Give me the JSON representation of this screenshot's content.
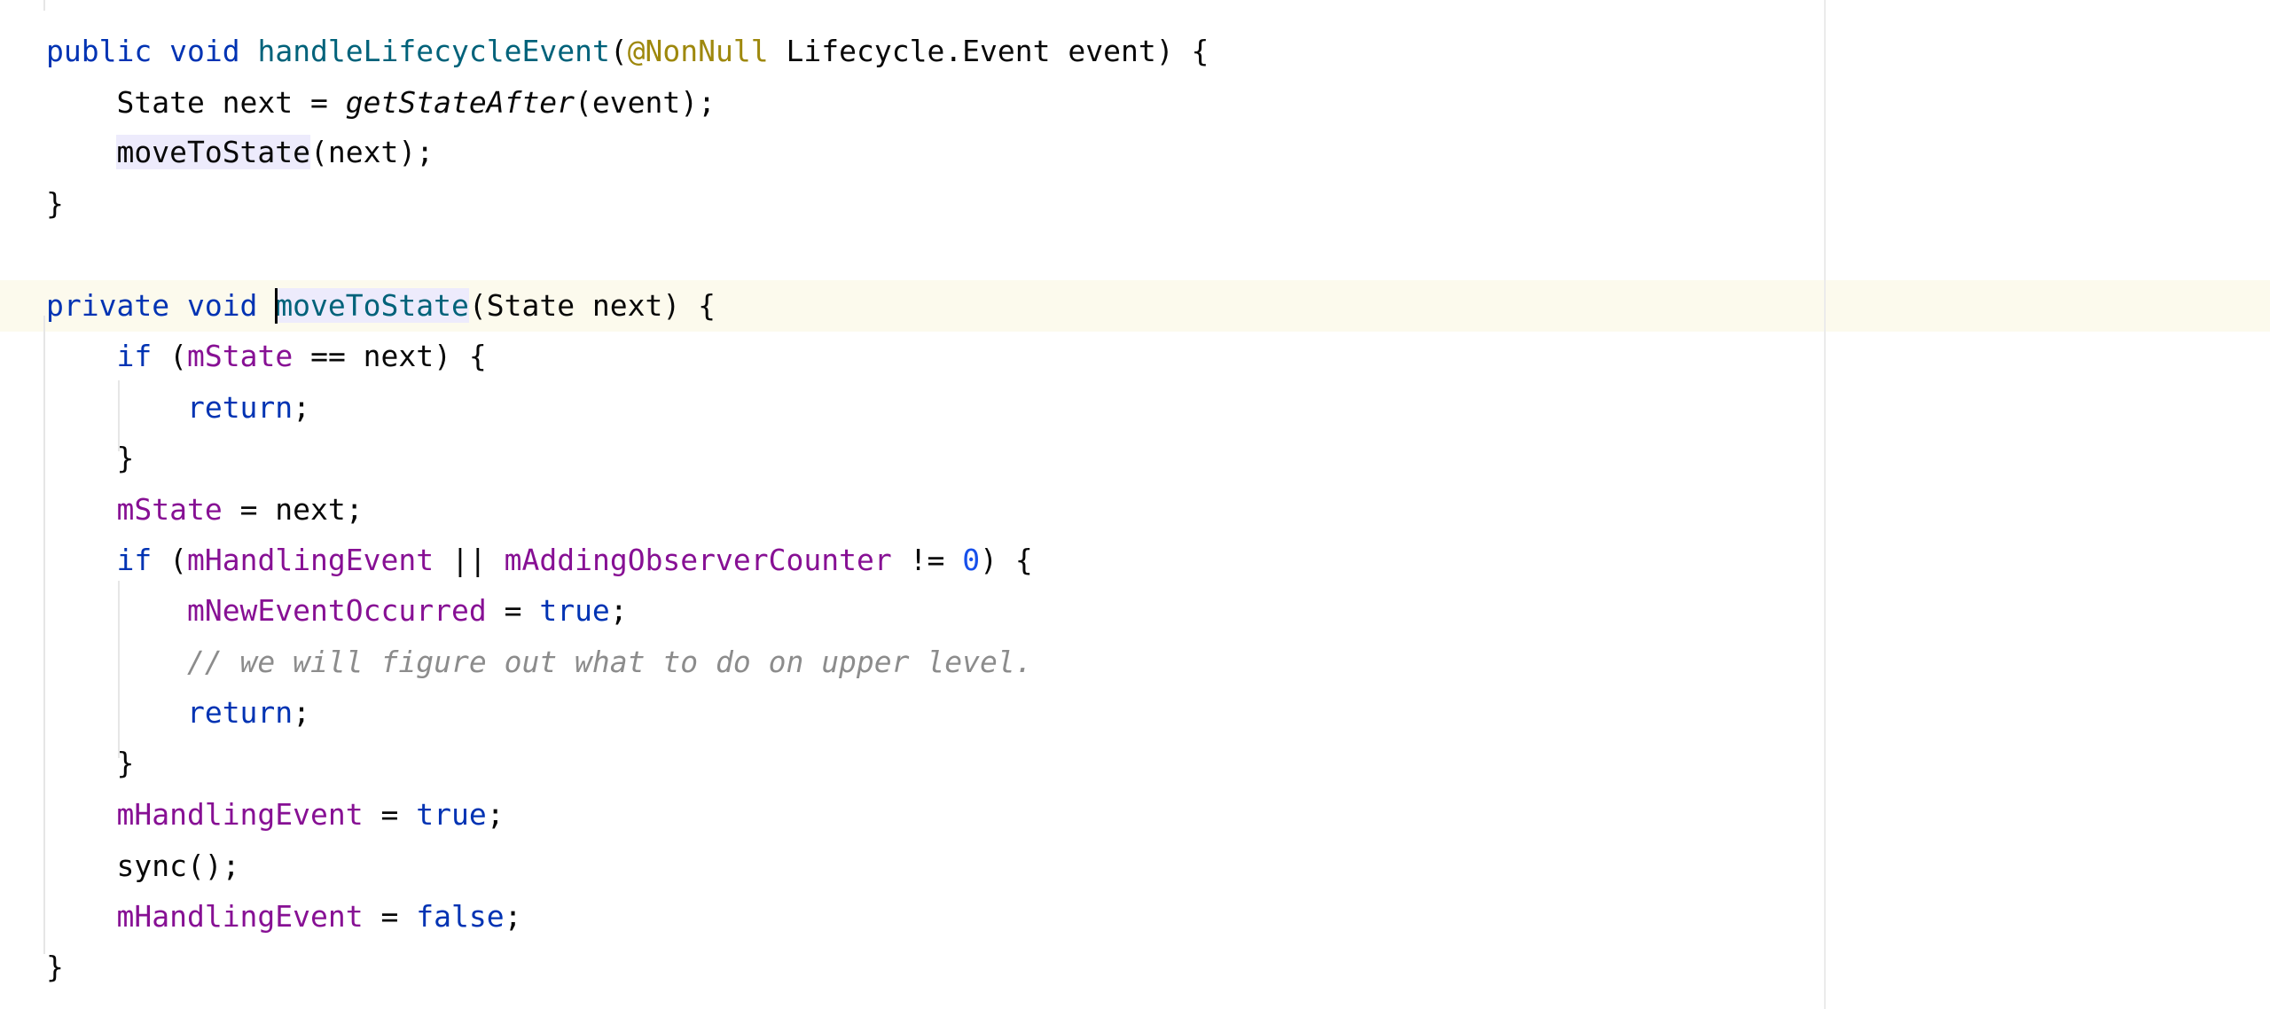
{
  "editor": {
    "lines": [
      {
        "tokens": [
          {
            "t": "public",
            "c": "kw"
          },
          {
            "t": " "
          },
          {
            "t": "void",
            "c": "kw"
          },
          {
            "t": " "
          },
          {
            "t": "handleLifecycleEvent",
            "c": "fn"
          },
          {
            "t": "("
          },
          {
            "t": "@NonNull",
            "c": "ann"
          },
          {
            "t": " Lifecycle.Event event) {"
          }
        ]
      },
      {
        "tokens": [
          {
            "t": "    State next = "
          },
          {
            "t": "getStateAfter",
            "c": "ital"
          },
          {
            "t": "(event);"
          }
        ]
      },
      {
        "tokens": [
          {
            "t": "    "
          },
          {
            "t": "moveToState",
            "c": "usage-hl"
          },
          {
            "t": "(next);"
          }
        ]
      },
      {
        "tokens": [
          {
            "t": "}"
          }
        ]
      },
      {
        "tokens": []
      },
      {
        "tokens": [
          {
            "t": "private",
            "c": "kw"
          },
          {
            "t": " "
          },
          {
            "t": "void",
            "c": "kw"
          },
          {
            "t": " "
          },
          {
            "caret": true
          },
          {
            "t": "moveToState",
            "c": "fn usage-hl"
          },
          {
            "t": "(State next) {"
          }
        ]
      },
      {
        "tokens": [
          {
            "t": "    "
          },
          {
            "t": "if",
            "c": "kw"
          },
          {
            "t": " ("
          },
          {
            "t": "mState",
            "c": "field"
          },
          {
            "t": " == next) {"
          }
        ]
      },
      {
        "tokens": [
          {
            "t": "        "
          },
          {
            "t": "return",
            "c": "kw"
          },
          {
            "t": ";"
          }
        ]
      },
      {
        "tokens": [
          {
            "t": "    }"
          }
        ]
      },
      {
        "tokens": [
          {
            "t": "    "
          },
          {
            "t": "mState",
            "c": "field"
          },
          {
            "t": " = next;"
          }
        ]
      },
      {
        "tokens": [
          {
            "t": "    "
          },
          {
            "t": "if",
            "c": "kw"
          },
          {
            "t": " ("
          },
          {
            "t": "mHandlingEvent",
            "c": "field"
          },
          {
            "t": " || "
          },
          {
            "t": "mAddingObserverCounter",
            "c": "field"
          },
          {
            "t": " != "
          },
          {
            "t": "0",
            "c": "num"
          },
          {
            "t": ") {"
          }
        ]
      },
      {
        "tokens": [
          {
            "t": "        "
          },
          {
            "t": "mNewEventOccurred",
            "c": "field"
          },
          {
            "t": " = "
          },
          {
            "t": "true",
            "c": "kw"
          },
          {
            "t": ";"
          }
        ]
      },
      {
        "tokens": [
          {
            "t": "        "
          },
          {
            "t": "// we will figure out what to do on upper level.",
            "c": "cmt"
          }
        ]
      },
      {
        "tokens": [
          {
            "t": "        "
          },
          {
            "t": "return",
            "c": "kw"
          },
          {
            "t": ";"
          }
        ]
      },
      {
        "tokens": [
          {
            "t": "    }"
          }
        ]
      },
      {
        "tokens": [
          {
            "t": "    "
          },
          {
            "t": "mHandlingEvent",
            "c": "field"
          },
          {
            "t": " = "
          },
          {
            "t": "true",
            "c": "kw"
          },
          {
            "t": ";"
          }
        ]
      },
      {
        "tokens": [
          {
            "t": "    sync();"
          }
        ]
      },
      {
        "tokens": [
          {
            "t": "    "
          },
          {
            "t": "mHandlingEvent",
            "c": "field"
          },
          {
            "t": " = "
          },
          {
            "t": "false",
            "c": "kw"
          },
          {
            "t": ";"
          }
        ]
      },
      {
        "tokens": [
          {
            "t": "}"
          }
        ]
      }
    ],
    "current_line": 6,
    "colors": {
      "keyword": "#0033b3",
      "method": "#00627a",
      "annotation": "#9e880d",
      "field": "#871094",
      "number": "#1750eb",
      "comment": "#8c8c8c",
      "usage_highlight": "#edebfc",
      "current_line": "#fcfaed"
    }
  }
}
